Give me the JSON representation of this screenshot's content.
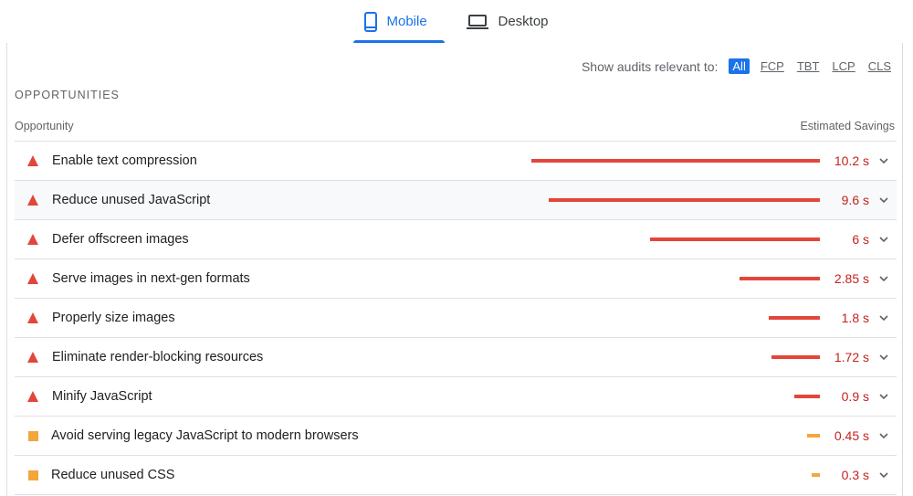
{
  "tabs": [
    {
      "label": "Mobile",
      "active": true
    },
    {
      "label": "Desktop",
      "active": false
    }
  ],
  "filter": {
    "label": "Show audits relevant to:",
    "chips": [
      "All",
      "FCP",
      "TBT",
      "LCP",
      "CLS"
    ],
    "selected": "All"
  },
  "section_title": "OPPORTUNITIES",
  "columns": {
    "left": "Opportunity",
    "right": "Estimated Savings"
  },
  "colors": {
    "accent": "#1a73e8",
    "fail": "#e2463a",
    "average": "#f2a63b",
    "value_text": "#c5221f"
  },
  "max_savings_s": 10.2,
  "opportunities": [
    {
      "title": "Enable text compression",
      "value": "10.2 s",
      "savings_s": 10.2,
      "status": "fail"
    },
    {
      "title": "Reduce unused JavaScript",
      "value": "9.6 s",
      "savings_s": 9.6,
      "status": "fail"
    },
    {
      "title": "Defer offscreen images",
      "value": "6 s",
      "savings_s": 6,
      "status": "fail"
    },
    {
      "title": "Serve images in next-gen formats",
      "value": "2.85 s",
      "savings_s": 2.85,
      "status": "fail"
    },
    {
      "title": "Properly size images",
      "value": "1.8 s",
      "savings_s": 1.8,
      "status": "fail"
    },
    {
      "title": "Eliminate render-blocking resources",
      "value": "1.72 s",
      "savings_s": 1.72,
      "status": "fail"
    },
    {
      "title": "Minify JavaScript",
      "value": "0.9 s",
      "savings_s": 0.9,
      "status": "fail"
    },
    {
      "title": "Avoid serving legacy JavaScript to modern browsers",
      "value": "0.45 s",
      "savings_s": 0.45,
      "status": "average"
    },
    {
      "title": "Reduce unused CSS",
      "value": "0.3 s",
      "savings_s": 0.3,
      "status": "average"
    }
  ]
}
